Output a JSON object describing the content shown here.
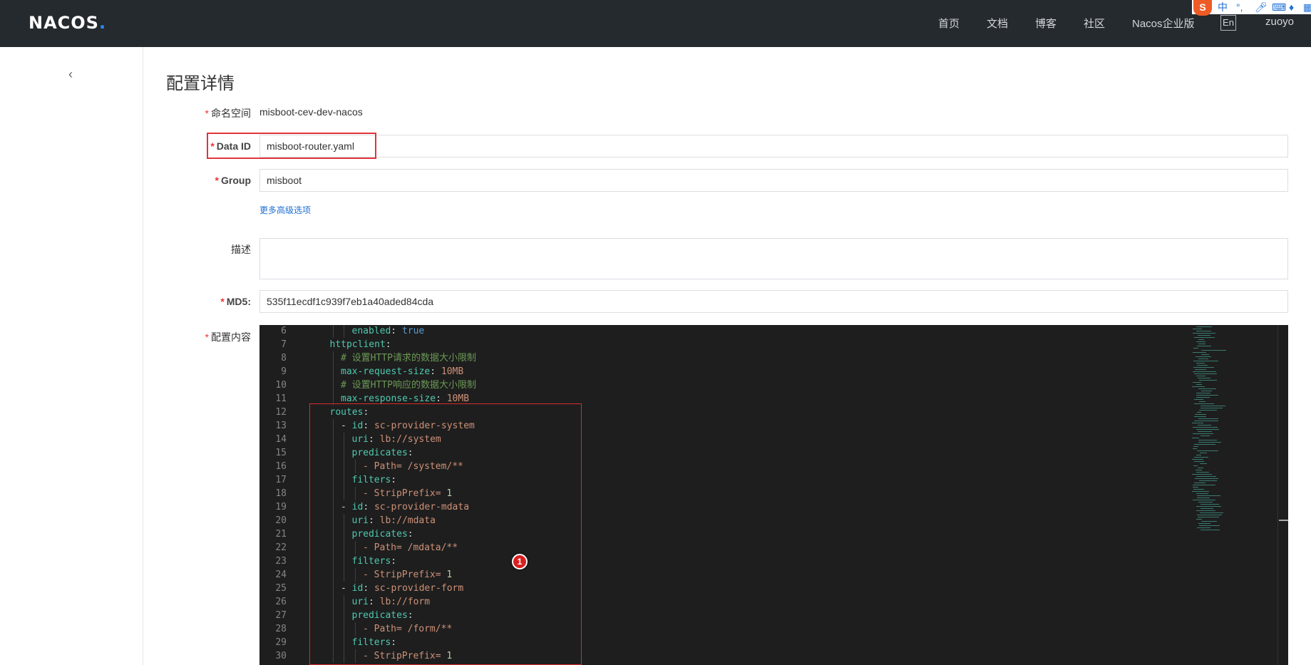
{
  "header": {
    "logo": "NACOS",
    "nav": [
      "首页",
      "文档",
      "博客",
      "社区",
      "Nacos企业版"
    ],
    "lang_button": "En",
    "user": "zuoyo",
    "ime_toolbar": {
      "brand": "S",
      "mode": "中",
      "icons": [
        "punctuation-icon",
        "mic-icon",
        "keyboard-icon",
        "skin-icon",
        "menu-icon"
      ]
    }
  },
  "sidebar": {
    "back_icon": "‹"
  },
  "page": {
    "title": "配置详情",
    "fields": {
      "namespace": {
        "label": "命名空间",
        "value": "misboot-cev-dev-nacos"
      },
      "data_id": {
        "label": "Data ID",
        "value": "misboot-router.yaml"
      },
      "group": {
        "label": "Group",
        "value": "misboot"
      },
      "advanced_link": "更多高级选项",
      "description": {
        "label": "描述",
        "value": ""
      },
      "md5": {
        "label": "MD5:",
        "value": "535f11ecdf1c939f7eb1a40aded84cda"
      },
      "content": {
        "label": "配置内容"
      }
    },
    "required_mark": "*"
  },
  "editor": {
    "lines": [
      {
        "no": "6",
        "indent": 5,
        "tokens": [
          {
            "t": "enabled",
            "c": "k"
          },
          {
            "t": ": ",
            "c": "w"
          },
          {
            "t": "true",
            "c": "b"
          }
        ]
      },
      {
        "no": "7",
        "indent": 3,
        "tokens": [
          {
            "t": "httpclient",
            "c": "k"
          },
          {
            "t": ":",
            "c": "w"
          }
        ]
      },
      {
        "no": "8",
        "indent": 4,
        "tokens": [
          {
            "t": "# 设置HTTP请求的数据大小限制",
            "c": "c"
          }
        ]
      },
      {
        "no": "9",
        "indent": 4,
        "tokens": [
          {
            "t": "max-request-size",
            "c": "k"
          },
          {
            "t": ": ",
            "c": "w"
          },
          {
            "t": "10MB",
            "c": "s"
          }
        ]
      },
      {
        "no": "10",
        "indent": 4,
        "tokens": [
          {
            "t": "# 设置HTTP响应的数据大小限制",
            "c": "c"
          }
        ]
      },
      {
        "no": "11",
        "indent": 4,
        "tokens": [
          {
            "t": "max-response-size",
            "c": "k"
          },
          {
            "t": ": ",
            "c": "w"
          },
          {
            "t": "10MB",
            "c": "s"
          }
        ]
      },
      {
        "no": "12",
        "indent": 3,
        "tokens": [
          {
            "t": "routes",
            "c": "k"
          },
          {
            "t": ":",
            "c": "w"
          }
        ]
      },
      {
        "no": "13",
        "indent": 4,
        "tokens": [
          {
            "t": "- ",
            "c": "w"
          },
          {
            "t": "id",
            "c": "k"
          },
          {
            "t": ": ",
            "c": "w"
          },
          {
            "t": "sc-provider-system",
            "c": "s"
          }
        ]
      },
      {
        "no": "14",
        "indent": 5,
        "tokens": [
          {
            "t": "uri",
            "c": "k"
          },
          {
            "t": ": ",
            "c": "w"
          },
          {
            "t": "lb://system",
            "c": "s"
          }
        ]
      },
      {
        "no": "15",
        "indent": 5,
        "tokens": [
          {
            "t": "predicates",
            "c": "k"
          },
          {
            "t": ":",
            "c": "w"
          }
        ]
      },
      {
        "no": "16",
        "indent": 6,
        "tokens": [
          {
            "t": "- Path= /system/**",
            "c": "s"
          }
        ]
      },
      {
        "no": "17",
        "indent": 5,
        "tokens": [
          {
            "t": "filters",
            "c": "k"
          },
          {
            "t": ":",
            "c": "w"
          }
        ]
      },
      {
        "no": "18",
        "indent": 6,
        "tokens": [
          {
            "t": "- StripPrefix= ",
            "c": "s"
          },
          {
            "t": "1",
            "c": "n"
          }
        ]
      },
      {
        "no": "19",
        "indent": 4,
        "tokens": [
          {
            "t": "- ",
            "c": "w"
          },
          {
            "t": "id",
            "c": "k"
          },
          {
            "t": ": ",
            "c": "w"
          },
          {
            "t": "sc-provider-mdata",
            "c": "s"
          }
        ]
      },
      {
        "no": "20",
        "indent": 5,
        "tokens": [
          {
            "t": "uri",
            "c": "k"
          },
          {
            "t": ": ",
            "c": "w"
          },
          {
            "t": "lb://mdata",
            "c": "s"
          }
        ]
      },
      {
        "no": "21",
        "indent": 5,
        "tokens": [
          {
            "t": "predicates",
            "c": "k"
          },
          {
            "t": ":",
            "c": "w"
          }
        ]
      },
      {
        "no": "22",
        "indent": 6,
        "tokens": [
          {
            "t": "- Path= /mdata/**",
            "c": "s"
          }
        ]
      },
      {
        "no": "23",
        "indent": 5,
        "tokens": [
          {
            "t": "filters",
            "c": "k"
          },
          {
            "t": ":",
            "c": "w"
          }
        ]
      },
      {
        "no": "24",
        "indent": 6,
        "tokens": [
          {
            "t": "- StripPrefix= ",
            "c": "s"
          },
          {
            "t": "1",
            "c": "n"
          }
        ]
      },
      {
        "no": "25",
        "indent": 4,
        "tokens": [
          {
            "t": "- ",
            "c": "w"
          },
          {
            "t": "id",
            "c": "k"
          },
          {
            "t": ": ",
            "c": "w"
          },
          {
            "t": "sc-provider-form",
            "c": "s"
          }
        ]
      },
      {
        "no": "26",
        "indent": 5,
        "tokens": [
          {
            "t": "uri",
            "c": "k"
          },
          {
            "t": ": ",
            "c": "w"
          },
          {
            "t": "lb://form",
            "c": "s"
          }
        ]
      },
      {
        "no": "27",
        "indent": 5,
        "tokens": [
          {
            "t": "predicates",
            "c": "k"
          },
          {
            "t": ":",
            "c": "w"
          }
        ]
      },
      {
        "no": "28",
        "indent": 6,
        "tokens": [
          {
            "t": "- Path= /form/**",
            "c": "s"
          }
        ]
      },
      {
        "no": "29",
        "indent": 5,
        "tokens": [
          {
            "t": "filters",
            "c": "k"
          },
          {
            "t": ":",
            "c": "w"
          }
        ]
      },
      {
        "no": "30",
        "indent": 6,
        "tokens": [
          {
            "t": "- StripPrefix= ",
            "c": "s"
          },
          {
            "t": "1",
            "c": "n"
          }
        ]
      }
    ]
  },
  "annotation": {
    "marker_label": "1"
  },
  "colors": {
    "header_bg": "#252a2f",
    "editor_bg": "#1e1e1e",
    "highlight_red": "#e0353b",
    "link_blue": "#1f6fd6"
  }
}
